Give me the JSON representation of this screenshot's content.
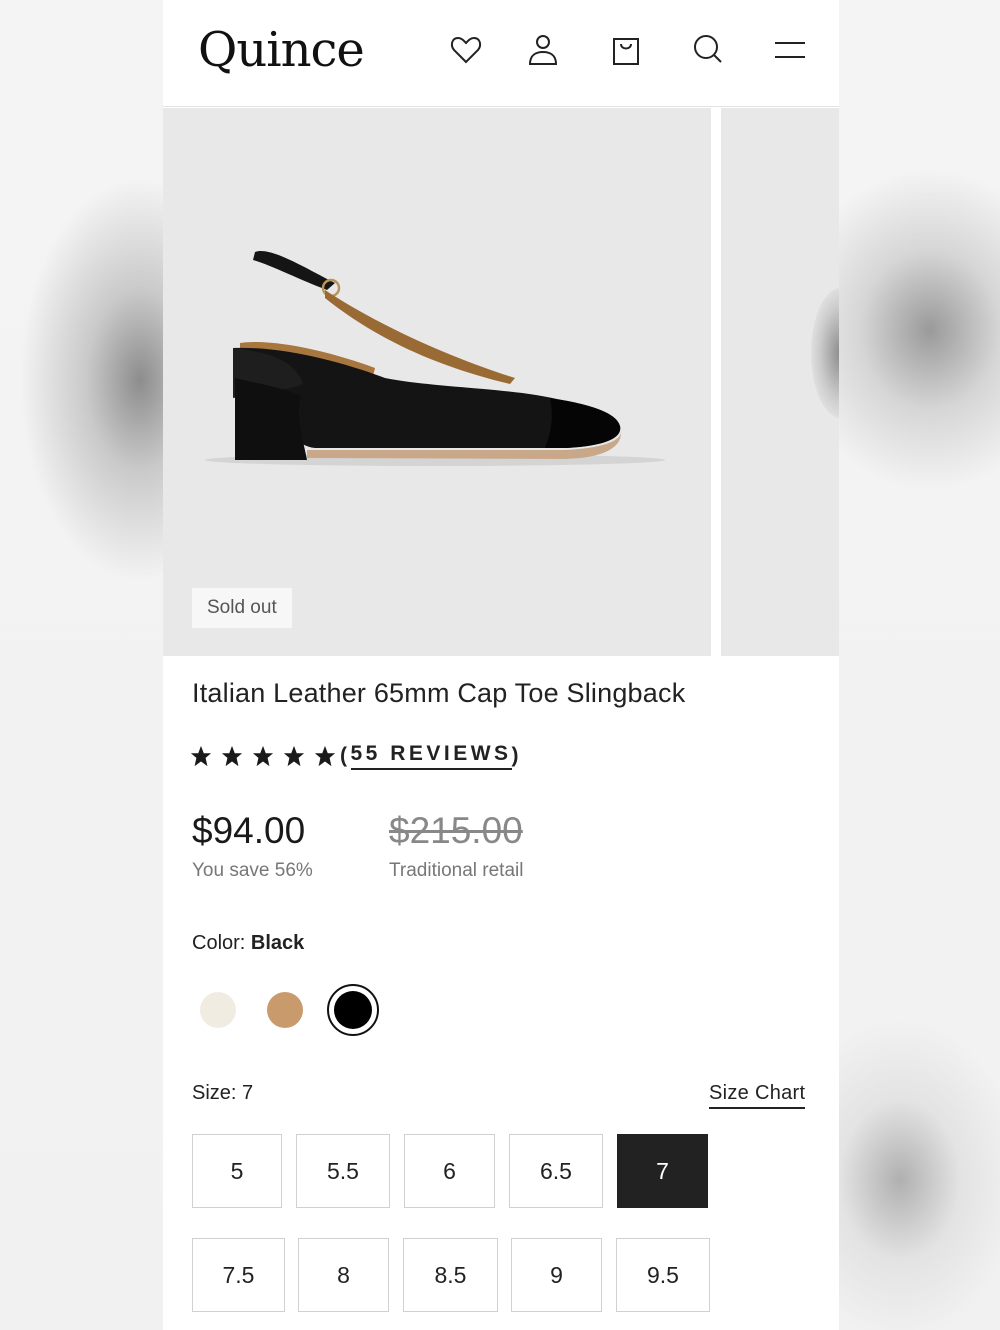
{
  "brand": {
    "logo_text": "Quince"
  },
  "header": {
    "icons": [
      "heart-icon",
      "account-icon",
      "bag-icon",
      "search-icon",
      "menu-icon"
    ]
  },
  "gallery": {
    "badge": "Sold out"
  },
  "product": {
    "title": "Italian Leather 65mm Cap Toe Slingback",
    "rating_stars": 5,
    "reviews_label": "(55 REVIEWS)",
    "reviews_open": "(",
    "reviews_text": "55 REVIEWS",
    "reviews_close": ")",
    "price": "$94.00",
    "savings": "You save 56%",
    "retail_price": "$215.00",
    "retail_label": "Traditional retail"
  },
  "color": {
    "label_prefix": "Color:",
    "selected": "Black",
    "swatches": [
      {
        "name": "Ivory",
        "hex": "#f1ece2"
      },
      {
        "name": "Tan",
        "hex": "#c99a6c"
      },
      {
        "name": "Black",
        "hex": "#000000"
      }
    ]
  },
  "size": {
    "label_prefix": "Size:",
    "selected": "7",
    "chart_link": "Size Chart",
    "options": [
      "5",
      "5.5",
      "6",
      "6.5",
      "7",
      "7.5",
      "8",
      "8.5",
      "9",
      "9.5"
    ]
  }
}
